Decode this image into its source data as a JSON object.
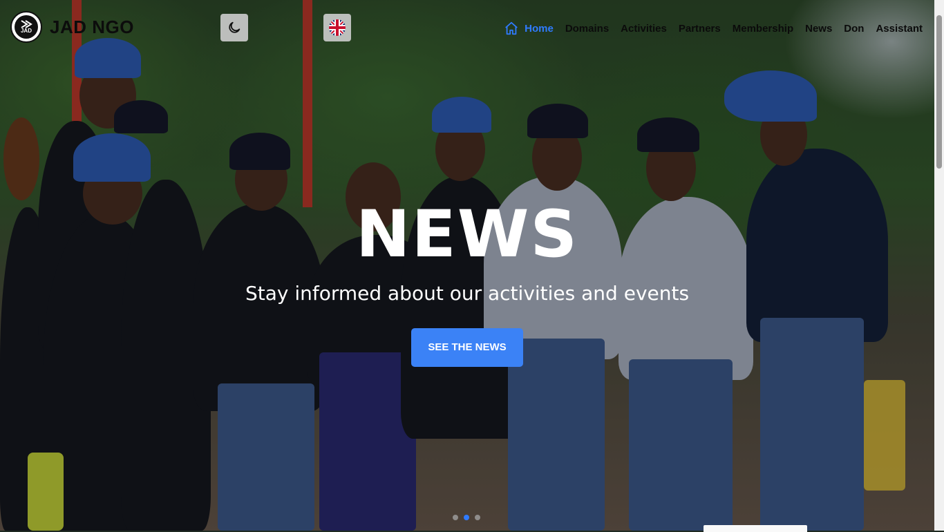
{
  "header": {
    "brand": "JAD NGO",
    "logo_text": "JAD",
    "theme_toggle_icon": "moon-icon",
    "language_icon": "uk-flag-icon"
  },
  "nav": {
    "items": [
      {
        "label": "Home",
        "active": true,
        "icon": "home-icon"
      },
      {
        "label": "Domains"
      },
      {
        "label": "Activities"
      },
      {
        "label": "Partners"
      },
      {
        "label": "Membership"
      },
      {
        "label": "News"
      },
      {
        "label": "Don"
      },
      {
        "label": "Assistant"
      }
    ]
  },
  "hero": {
    "title": "NEWS",
    "subtitle": "Stay informed about our activities and events",
    "button_label": "SEE THE NEWS",
    "carousel": {
      "slides": 3,
      "active_index": 1
    }
  },
  "colors": {
    "accent": "#3b82f6",
    "active_nav": "#2f7bff"
  }
}
